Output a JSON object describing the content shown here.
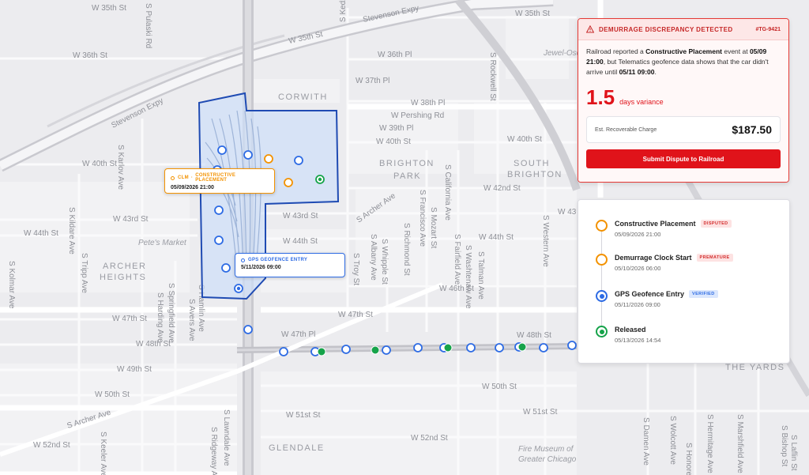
{
  "map": {
    "areas": [
      "CORWITH",
      "BRIGHTON",
      "PARK",
      "SOUTH",
      "BRIGHTON",
      "ARCHER",
      "HEIGHTS",
      "THE YARDS",
      "GLENDALE"
    ],
    "streets": {
      "w35": "W 35th St",
      "stevenson_top": "Stevenson Expy",
      "stevenson_left": "Stevenson Expy",
      "w35_mid": "W 35th St",
      "w35_right": "W 35th St",
      "w36": "W 36th St",
      "w36pl": "W 36th Pl",
      "w37pl": "W 37th Pl",
      "w38pl": "W 38th Pl",
      "pershing": "W Pershing Rd",
      "w39pl": "W 39th Pl",
      "w40_mid": "W 40th St",
      "w40_left": "W 40th St",
      "w40_right": "W 40th St",
      "w42": "W 42nd St",
      "w43_left": "W 43rd St",
      "w43_mid": "W 43rd St",
      "w43_right": "W 43",
      "w44_left": "W 44th St",
      "w44_mid": "W 44th St",
      "w44_right": "W 44th St",
      "w46": "W 46th St",
      "w47_left": "W 47th St",
      "w47_mid": "W 47th St",
      "w47pl": "W 47th Pl",
      "w48": "W 48th St",
      "w48_right": "W 48th St",
      "w49": "W 49th St",
      "w50_left": "W 50th St",
      "w50_right": "W 50th St",
      "archer_low": "S Archer Ave",
      "archer_mid": "S Archer Ave",
      "w51_mid": "W 51st St",
      "w51_right": "W 51st St",
      "w52": "W 52nd St",
      "w52_mid": "W 52nd St",
      "pulaski": "S Pulaski Rd",
      "kedzie": "S Kedzie Ave",
      "karlov": "S Karlov Ave",
      "kildare": "S Kildare Ave",
      "kolmar": "S Kolmar Ave",
      "tripp": "S Tripp Ave",
      "hamlin": "S Hamlin Ave",
      "springfield": "S Springfield Ave",
      "harding": "S Harding Ave",
      "avers": "S Avers Ave",
      "albany": "S Albany Ave",
      "whipple": "S Whipple St",
      "richmond": "S Richmond St",
      "troy": "S Troy St",
      "francisco": "S Francisco Ave",
      "mozart": "S Mozart St",
      "california": "S California Ave",
      "fairfield": "S Fairfield Ave",
      "washtenaw": "S Washtenaw Ave",
      "talman": "S Talman Ave",
      "rockwell": "S Rockwell St",
      "western": "S Western Ave",
      "lawndale": "S Lawndale Ave",
      "ridgeway": "S Ridgeway Ave",
      "keeler": "S Keeler Ave",
      "damen": "S Damen Ave",
      "wolcott": "S Wolcott Ave",
      "hermitage": "S Hermitage Ave",
      "marshfield": "S Marshfield Ave",
      "bishop": "S Bishop St",
      "laflin": "S Laflin St",
      "honore": "S Honore St",
      "archer_ave_label": "S Archer Ave"
    },
    "pois": {
      "petes": "Pete's Market",
      "jewel": "Jewel-Osco",
      "fire1": "Fire Museum of",
      "fire2": "Greater Chicago"
    }
  },
  "callouts": {
    "clm": {
      "source": "CLM",
      "separator": "·",
      "event": "CONSTRUCTIVE PLACEMENT",
      "datetime": "05/09/2026  21:00",
      "color": "#f39200"
    },
    "gps": {
      "event": "GPS GEOFENCE ENTRY",
      "datetime": "5/11/2026  09:00",
      "color": "#2d6be4"
    }
  },
  "alert": {
    "title": "DEMURRAGE DISCREPANCY DETECTED",
    "id": "#TG-9421",
    "msg_1": "Railroad reported a ",
    "msg_event": "Constructive Placement",
    "msg_2": " event at ",
    "msg_date1": "05/09 21:00",
    "msg_3": ", but Telematics geofence data shows that the car didn't arrive until ",
    "msg_date2": "05/11 09:00",
    "msg_4": ".",
    "variance_value": "1.5",
    "variance_label": "days variance",
    "charge_label": "Est. Recoverable Charge",
    "charge_value": "$187.50",
    "button_label": "Submit Dispute to Railroad",
    "accent": "#e0131a"
  },
  "timeline": [
    {
      "name": "Constructive Placement",
      "badge": "DISPUTED",
      "time": "05/09/2026 21:00",
      "dot": "orange"
    },
    {
      "name": "Demurrage Clock Start",
      "badge": "PREMATURE",
      "time": "05/10/2026 06:00",
      "dot": "orange"
    },
    {
      "name": "GPS Geofence Entry",
      "badge": "VERIFIED",
      "time": "05/11/2026 09:00",
      "dot": "blue"
    },
    {
      "name": "Released",
      "badge": "",
      "time": "05/13/2026 14:54",
      "dot": "green"
    }
  ],
  "colors": {
    "orange": "#f39200",
    "blue": "#2d6be4",
    "green": "#16a34a",
    "red": "#e0131a"
  }
}
